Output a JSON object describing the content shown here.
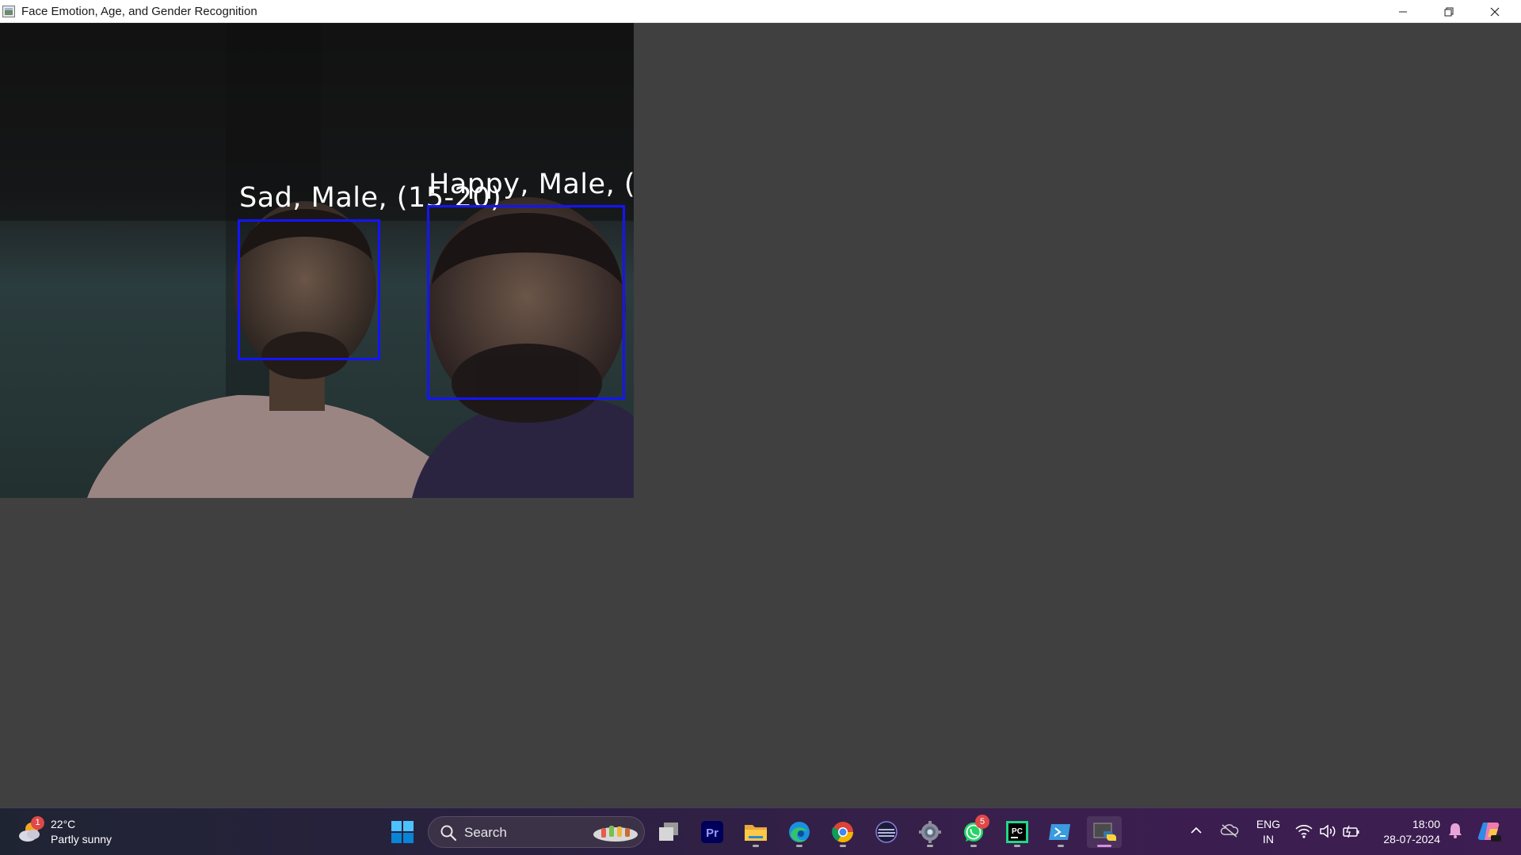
{
  "window": {
    "title": "Face Emotion, Age, and Gender Recognition"
  },
  "video": {
    "faces": [
      {
        "label": "Sad, Male, (15-20)"
      },
      {
        "label": "Happy, Male, ("
      }
    ],
    "box_color": "#1414ff"
  },
  "taskbar": {
    "weather": {
      "badge": "1",
      "temp": "22°C",
      "desc": "Partly sunny"
    },
    "search": {
      "placeholder": "Search"
    },
    "pinned": [
      "windows-start-icon",
      "task-view-icon",
      "premiere-pro-icon",
      "file-explorer-icon",
      "edge-icon",
      "chrome-icon",
      "media-app-icon",
      "settings-icon",
      "whatsapp-icon",
      "pycharm-icon",
      "terminal-icon",
      "python-app-icon"
    ],
    "whatsapp_badge": "5",
    "premiere_label": "Pr",
    "pycharm_label": "PC",
    "tray": {
      "lang_top": "ENG",
      "lang_bottom": "IN",
      "time": "18:00",
      "date": "28-07-2024"
    }
  }
}
